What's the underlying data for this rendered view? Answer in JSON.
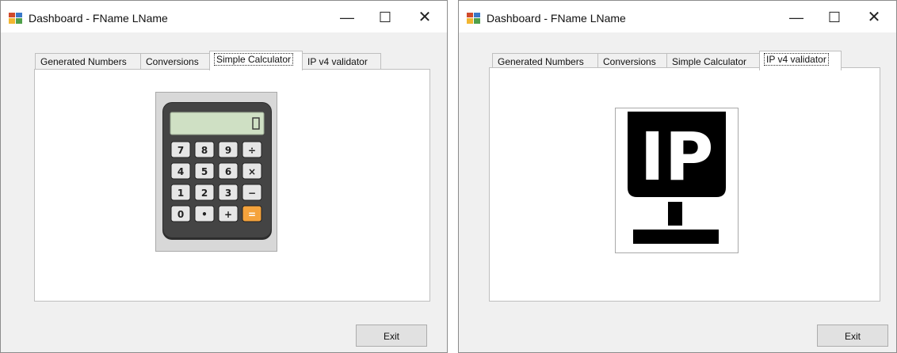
{
  "windows": [
    {
      "title": "Dashboard - FName LName",
      "controls": {
        "minimize": "—",
        "maximize": "☐",
        "close": "✕"
      },
      "tabs": [
        {
          "label": "Generated Numbers",
          "active": false
        },
        {
          "label": "Conversions",
          "active": false
        },
        {
          "label": "Simple Calculator",
          "active": true
        },
        {
          "label": "IP v4 validator",
          "active": false
        }
      ],
      "image_icon": "calculator-icon",
      "calculator": {
        "display": "0",
        "keys": [
          "7",
          "8",
          "9",
          "÷",
          "4",
          "5",
          "6",
          "×",
          "1",
          "2",
          "3",
          "−",
          "0",
          "•",
          "+",
          "="
        ]
      },
      "exit_label": "Exit"
    },
    {
      "title": "Dashboard - FName LName",
      "controls": {
        "minimize": "—",
        "maximize": "☐",
        "close": "✕"
      },
      "tabs": [
        {
          "label": "Generated Numbers",
          "active": false
        },
        {
          "label": "Conversions",
          "active": false
        },
        {
          "label": "Simple Calculator",
          "active": false
        },
        {
          "label": "IP v4 validator",
          "active": true
        }
      ],
      "image_icon": "ip-address-icon",
      "ip_logo_text": "IP",
      "exit_label": "Exit"
    }
  ],
  "colors": {
    "accent_orange": "#f5a33c",
    "calculator_body": "#3c3c3c",
    "display": "#cfe0c4"
  }
}
